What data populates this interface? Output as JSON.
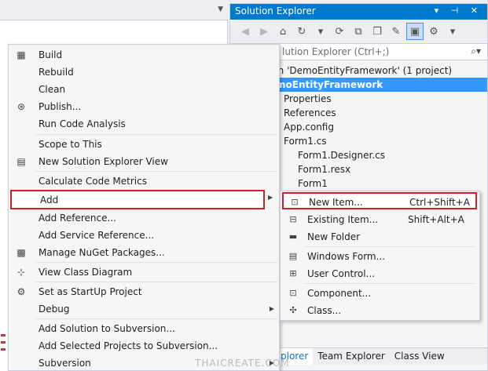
{
  "solution_explorer": {
    "title": "Solution Explorer",
    "title_buttons": "▾ ⊣ ✕",
    "search_placeholder": "lution Explorer (Ctrl+;)",
    "tree": [
      {
        "label": "ion 'DemoEntityFramework' (1 project)",
        "selected": false
      },
      {
        "label": "moEntityFramework",
        "selected": true
      },
      {
        "label": "Properties",
        "selected": false
      },
      {
        "label": "References",
        "selected": false
      },
      {
        "label": "App.config",
        "selected": false
      },
      {
        "label": "Form1.cs",
        "selected": false
      },
      {
        "label": "Form1.Designer.cs",
        "selected": false
      },
      {
        "label": "Form1.resx",
        "selected": false
      },
      {
        "label": "Form1",
        "selected": false
      }
    ],
    "tabs": [
      "plorer",
      "Team Explorer",
      "Class View"
    ]
  },
  "context_menu": {
    "items": [
      {
        "label": "Build",
        "icon": "build-icon"
      },
      {
        "label": "Rebuild"
      },
      {
        "label": "Clean"
      },
      {
        "label": "Publish...",
        "icon": "publish-icon"
      },
      {
        "label": "Run Code Analysis"
      },
      {
        "label": "Scope to This"
      },
      {
        "label": "New Solution Explorer View",
        "icon": "new-view-icon"
      },
      {
        "label": "Calculate Code Metrics"
      },
      {
        "label": "Add",
        "submenu": true,
        "highlighted": true
      },
      {
        "label": "Add Reference..."
      },
      {
        "label": "Add Service Reference..."
      },
      {
        "label": "Manage NuGet Packages...",
        "icon": "nuget-icon"
      },
      {
        "label": "View Class Diagram",
        "icon": "class-diagram-icon"
      },
      {
        "label": "Set as StartUp Project",
        "icon": "gear-icon"
      },
      {
        "label": "Debug",
        "submenu": true
      },
      {
        "label": "Add Solution to Subversion..."
      },
      {
        "label": "Add Selected Projects to Subversion..."
      },
      {
        "label": "Subversion",
        "submenu": true
      }
    ]
  },
  "add_submenu": {
    "items": [
      {
        "label": "New Item...",
        "shortcut": "Ctrl+Shift+A",
        "highlighted": true
      },
      {
        "label": "Existing Item...",
        "shortcut": "Shift+Alt+A"
      },
      {
        "label": "New Folder",
        "shortcut": ""
      },
      {
        "label": "Windows Form...",
        "shortcut": ""
      },
      {
        "label": "User Control...",
        "shortcut": ""
      },
      {
        "label": "Component...",
        "shortcut": ""
      },
      {
        "label": "Class...",
        "shortcut": ""
      }
    ]
  },
  "watermark": "THAICREATE.COM",
  "colors": {
    "accent": "#007acc",
    "selection": "#3399ff",
    "highlight_border": "#d21e28"
  }
}
